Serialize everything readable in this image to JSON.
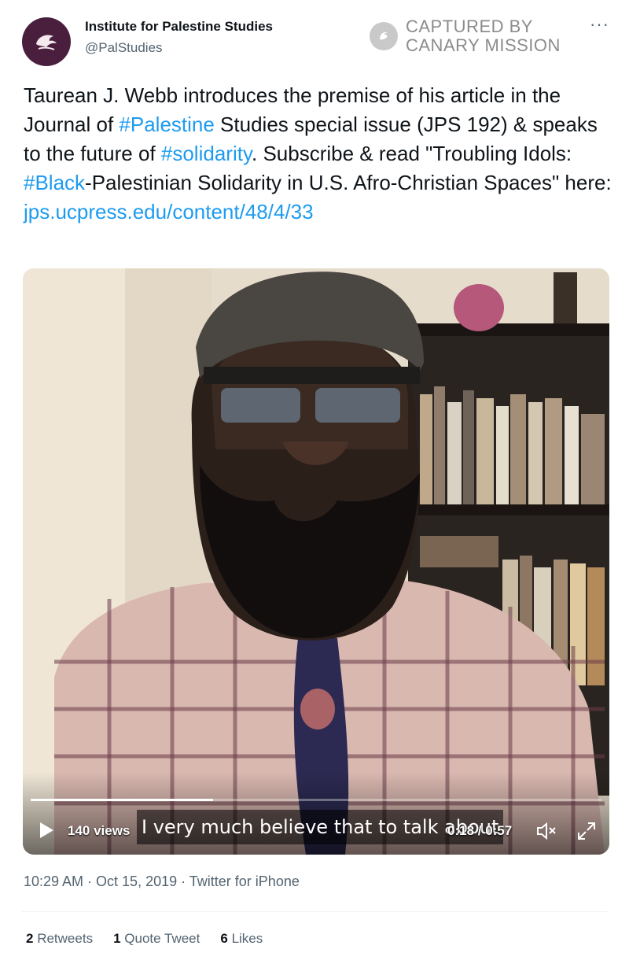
{
  "author": {
    "name": "Institute for Palestine Studies",
    "handle": "@PalStudies"
  },
  "watermark": {
    "line1": "CAPTURED BY",
    "line2": "CANARY MISSION"
  },
  "more_label": "···",
  "tweet": {
    "segments": [
      {
        "text": "Taurean J. Webb introduces the premise of his article in the Journal of ",
        "link": false
      },
      {
        "text": "#Palestine",
        "link": true
      },
      {
        "text": " Studies special issue (JPS 192) & speaks to the future of ",
        "link": false
      },
      {
        "text": "#solidarity",
        "link": true
      },
      {
        "text": ". Subscribe & read \"Troubling Idols: ",
        "link": false
      },
      {
        "text": "#Black",
        "link": true
      },
      {
        "text": "-Palestinian Solidarity in U.S. Afro-Christian Spaces\" here: ",
        "link": false
      },
      {
        "text": "jps.ucpress.edu/content/48/4/33",
        "link": true
      }
    ]
  },
  "video": {
    "views": "140 views",
    "subtitle": "I very much believe that to talk about",
    "current_time": "0:18",
    "duration": "0:57",
    "time_display": "0:18 / 0:57",
    "progress_fraction": 0.32
  },
  "meta": {
    "time": "10:29 AM",
    "date": "Oct 15, 2019",
    "source": "Twitter for iPhone",
    "line": "10:29 AM · Oct 15, 2019 · Twitter for iPhone"
  },
  "stats": {
    "retweets_count": "2",
    "retweets_label": "Retweets",
    "quotes_count": "1",
    "quotes_label": "Quote Tweet",
    "likes_count": "6",
    "likes_label": "Likes"
  },
  "colors": {
    "link": "#1d9bf0",
    "avatar_bg": "#4a1f3d",
    "secondary_text": "#536471"
  }
}
